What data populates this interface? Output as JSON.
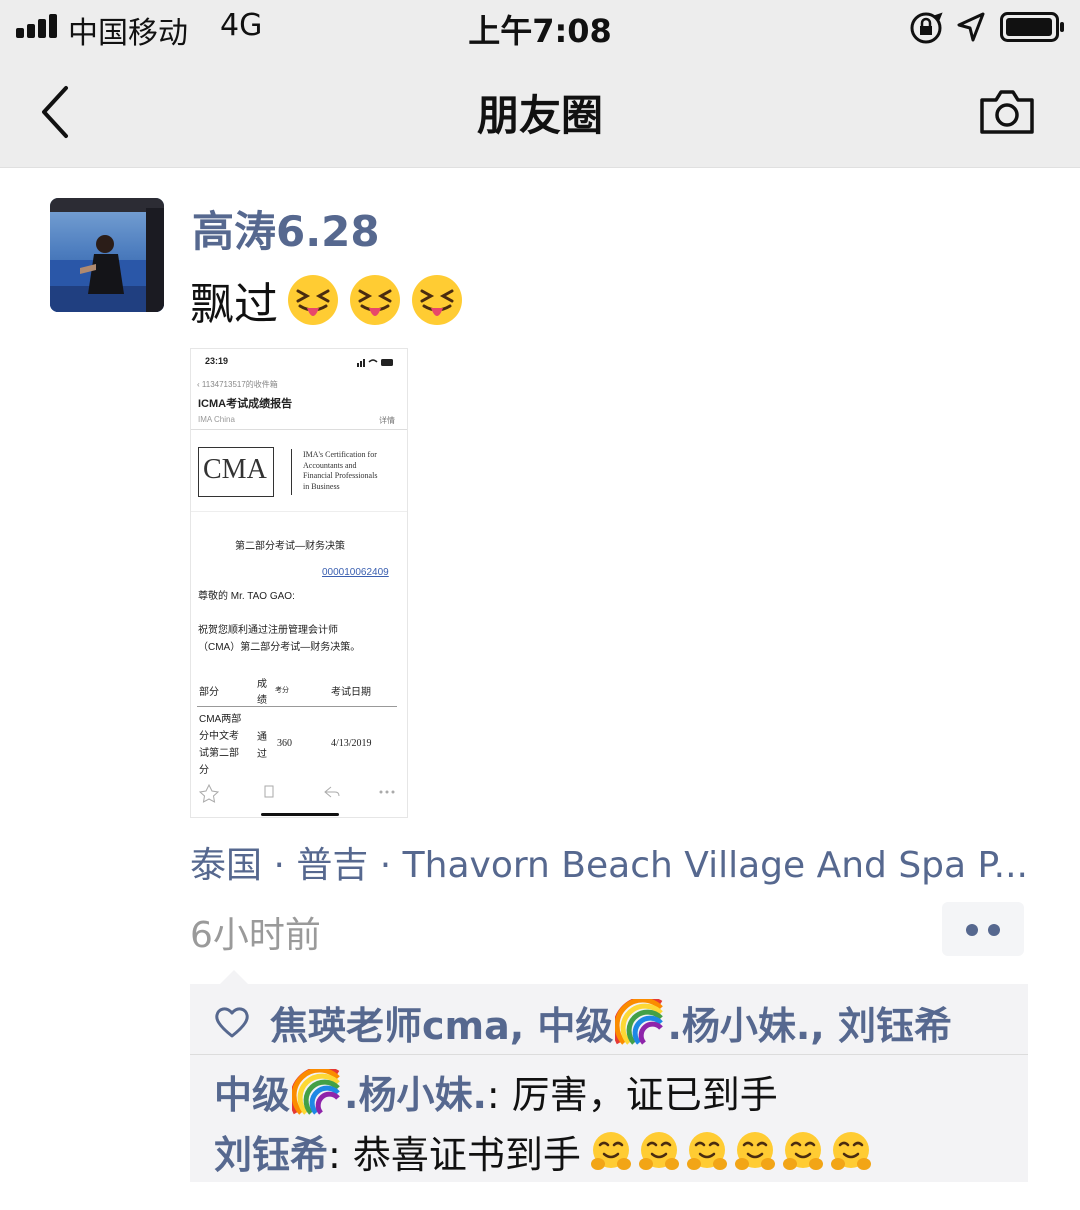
{
  "status_bar": {
    "carrier": "中国移动",
    "network": "4G",
    "time": "上午7:08",
    "icons": [
      "signal-icon",
      "orientation-lock-icon",
      "location-arrow-icon",
      "battery-icon"
    ]
  },
  "nav": {
    "title": "朋友圈",
    "back_icon": "chevron-left-icon",
    "camera_icon": "camera-icon"
  },
  "post": {
    "author": "高涛6.28",
    "text": "飘过",
    "emojis": [
      "squint-tongue-emoji",
      "squint-tongue-emoji",
      "squint-tongue-emoji"
    ],
    "location": "泰国 · 普吉 · Thavorn Beach Village And Spa P...",
    "time_ago": "6小时前",
    "screenshot": {
      "time": "23:19",
      "back_text": "1134713517的收件箱",
      "subject": "ICMA考试成绩报告",
      "sender": "IMA China",
      "detail": "详情",
      "logo": "CMA",
      "cert_lines": [
        "IMA's Certification for",
        "Accountants and",
        "Financial Professionals",
        "in Business"
      ],
      "exam_title": "第二部分考试—财务决策",
      "ref_number": "000010062409",
      "greeting": "尊敬的 Mr. TAO GAO:",
      "body_line1": "祝贺您顺利通过注册管理会计师",
      "body_line2": "（CMA）第二部分考试—财务决策。",
      "col_part": "部分",
      "col_score_a": "成",
      "col_score_b": "绩",
      "col_points": "考分",
      "col_date": "考试日期",
      "row_part": [
        "CMA两部",
        "分中文考",
        "试第二部",
        "分"
      ],
      "row_result_a": "通",
      "row_result_b": "过",
      "row_points": "360",
      "row_date": "4/13/2019"
    }
  },
  "likes": {
    "icon": "heart-outline-icon",
    "part1": "焦瑛老师cma, 中级",
    "part2": ".杨小妹., 刘钰希"
  },
  "comments": [
    {
      "name_a": "中级",
      "name_b": ".杨小妹.",
      "text": ": 厉害，证已到手"
    },
    {
      "name": "刘钰希",
      "text": ": 恭喜证书到手",
      "emoji_count": 6
    }
  ],
  "colors": {
    "link": "#56688f",
    "bar_bg": "#ededed",
    "comment_bg": "#f3f3f5",
    "muted": "#9a9a9a"
  }
}
